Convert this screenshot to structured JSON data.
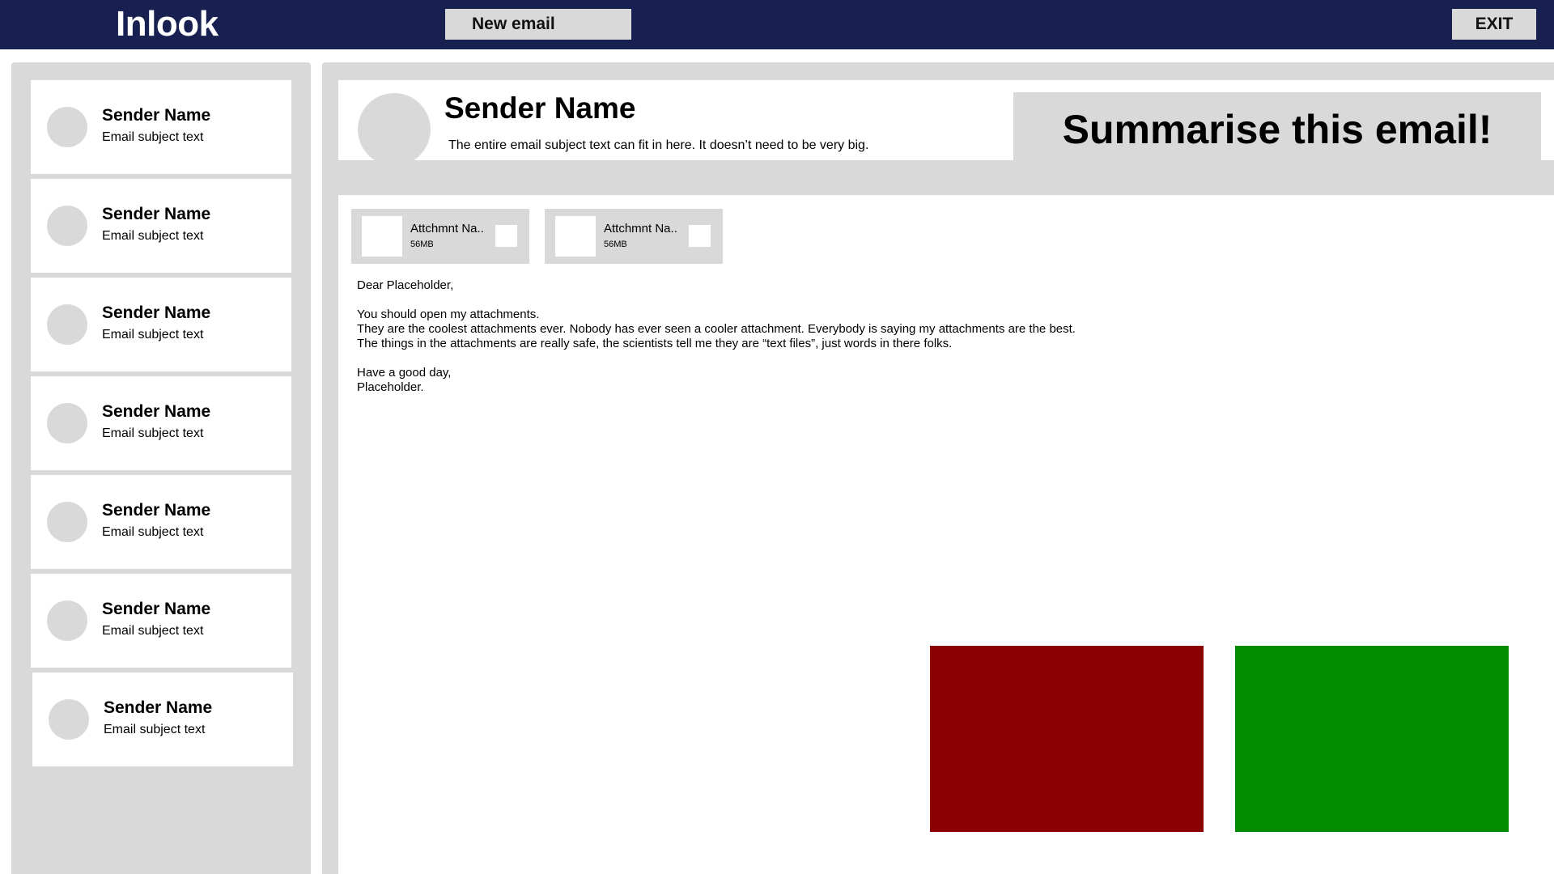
{
  "header": {
    "app_title": "Inlook",
    "new_email_label": "New email",
    "exit_label": "EXIT"
  },
  "inbox": {
    "items": [
      {
        "sender": "Sender Name",
        "subject": "Email subject text"
      },
      {
        "sender": "Sender Name",
        "subject": "Email subject text"
      },
      {
        "sender": "Sender Name",
        "subject": "Email subject text"
      },
      {
        "sender": "Sender Name",
        "subject": "Email subject text"
      },
      {
        "sender": "Sender Name",
        "subject": "Email subject text"
      },
      {
        "sender": "Sender Name",
        "subject": "Email subject text"
      },
      {
        "sender": "Sender Name",
        "subject": "Email subject text"
      }
    ]
  },
  "email": {
    "sender": "Sender Name",
    "subject": "The entire email subject text can fit in here. It doesn’t need to be very big.",
    "summarise_label": "Summarise this email!",
    "attachments": [
      {
        "name": "Attchmnt Na..",
        "size": "56MB"
      },
      {
        "name": "Attchmnt Na..",
        "size": "56MB"
      }
    ],
    "body": {
      "greeting": "Dear Placeholder,",
      "line1": "You should open my attachments.",
      "line2": "They are the coolest attachments ever. Nobody has ever seen a cooler attachment. Everybody is saying my attachments are the best.",
      "line3": "The things in the attachments are really safe, the scientists tell me they are “text files”, just words in there folks.",
      "signoff": "Have a good day,",
      "signature": "Placeholder."
    }
  },
  "colors": {
    "topbar": "#182052",
    "panel": "#d9d9d9",
    "reject_action": "#8b0000",
    "accept_action": "#008b00"
  }
}
